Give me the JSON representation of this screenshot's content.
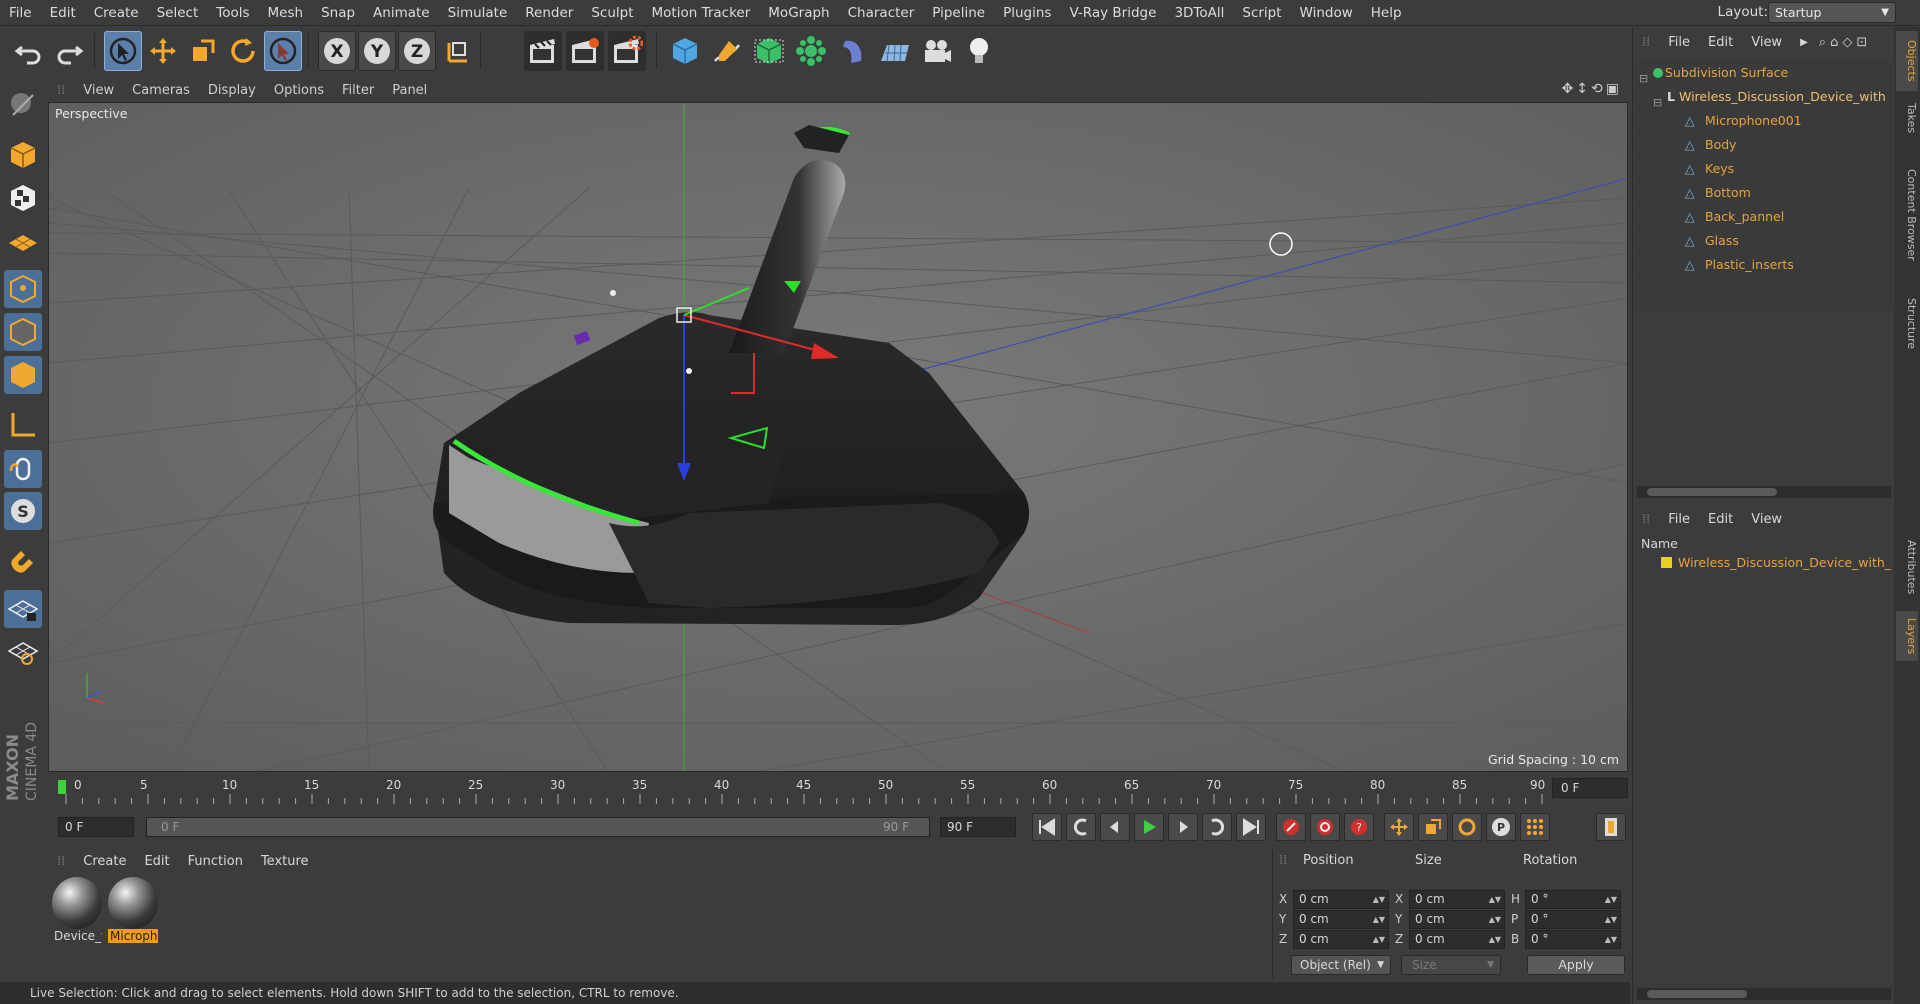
{
  "menubar": {
    "items": [
      "File",
      "Edit",
      "Create",
      "Select",
      "Tools",
      "Mesh",
      "Snap",
      "Animate",
      "Simulate",
      "Render",
      "Sculpt",
      "Motion Tracker",
      "MoGraph",
      "Character",
      "Pipeline",
      "Plugins",
      "V-Ray Bridge",
      "3DToAll",
      "Script",
      "Window",
      "Help"
    ],
    "layout_label": "Layout:",
    "layout_value": "Startup"
  },
  "toolbar": {
    "icons": [
      "undo-icon",
      "redo-icon",
      "live-selection-icon",
      "move-icon",
      "scale-icon",
      "rotate-icon",
      "last-tool-icon",
      "x-axis-icon",
      "y-axis-icon",
      "z-axis-icon",
      "world-coordinates-icon",
      "render-view-icon",
      "render-picture-viewer-icon",
      "render-settings-icon",
      "cube-icon",
      "pen-icon",
      "subdivision-icon",
      "cloner-icon",
      "deformer-icon",
      "floor-icon",
      "camera-icon",
      "light-icon"
    ],
    "axis_labels": [
      "X",
      "Y",
      "Z"
    ]
  },
  "viewport": {
    "menu": [
      "View",
      "Cameras",
      "Display",
      "Options",
      "Filter",
      "Panel"
    ],
    "label": "Perspective",
    "grid_spacing": "Grid Spacing : 10 cm"
  },
  "timeline": {
    "ticks": [
      "0",
      "5",
      "10",
      "15",
      "20",
      "25",
      "30",
      "35",
      "40",
      "45",
      "50",
      "55",
      "60",
      "65",
      "70",
      "75",
      "80",
      "85",
      "90"
    ],
    "current_frame": "0 F"
  },
  "transport": {
    "start_field": "0 F",
    "slider_start": "0 F",
    "slider_end": "90 F",
    "end_field": "90 F"
  },
  "materials": {
    "menu": [
      "Create",
      "Edit",
      "Function",
      "Texture"
    ],
    "items": [
      {
        "label": "Device_v",
        "selected": false
      },
      {
        "label": "Microph",
        "selected": true
      }
    ]
  },
  "coordinates": {
    "headers": [
      "Position",
      "Size",
      "Rotation"
    ],
    "position": [
      {
        "axis": "X",
        "value": "0 cm"
      },
      {
        "axis": "Y",
        "value": "0 cm"
      },
      {
        "axis": "Z",
        "value": "0 cm"
      }
    ],
    "size": [
      {
        "axis": "X",
        "value": "0 cm"
      },
      {
        "axis": "Y",
        "value": "0 cm"
      },
      {
        "axis": "Z",
        "value": "0 cm"
      }
    ],
    "rotation": [
      {
        "axis": "H",
        "value": "0 °"
      },
      {
        "axis": "P",
        "value": "0 °"
      },
      {
        "axis": "B",
        "value": "0 °"
      }
    ],
    "mode": "Object (Rel)",
    "size_mode": "Size",
    "apply": "Apply"
  },
  "status": "Live Selection: Click and drag to select elements. Hold down SHIFT to add to the selection, CTRL to remove.",
  "objects_panel": {
    "menu": [
      "File",
      "Edit",
      "View"
    ],
    "tree": [
      {
        "name": "Subdivision Surface",
        "depth": 0
      },
      {
        "name": "Wireless_Discussion_Device_with",
        "depth": 1
      },
      {
        "name": "Microphone001",
        "depth": 2
      },
      {
        "name": "Body",
        "depth": 2
      },
      {
        "name": "Keys",
        "depth": 2
      },
      {
        "name": "Bottom",
        "depth": 2
      },
      {
        "name": "Back_pannel",
        "depth": 2
      },
      {
        "name": "Glass",
        "depth": 2
      },
      {
        "name": "Plastic_inserts",
        "depth": 2
      }
    ]
  },
  "layers_panel": {
    "menu": [
      "File",
      "Edit",
      "View"
    ],
    "name_header": "Name",
    "layer": "Wireless_Discussion_Device_with_"
  },
  "side_tabs": [
    "Objects",
    "Takes",
    "Content Browser",
    "Structure",
    "Attributes",
    "Layers"
  ],
  "brand": "MAXON CINEMA 4D",
  "colors": {
    "accent": "#e7a33e",
    "selection": "#5b7fa8",
    "viewport": "#6f6f6f",
    "glow": "#39e639"
  }
}
